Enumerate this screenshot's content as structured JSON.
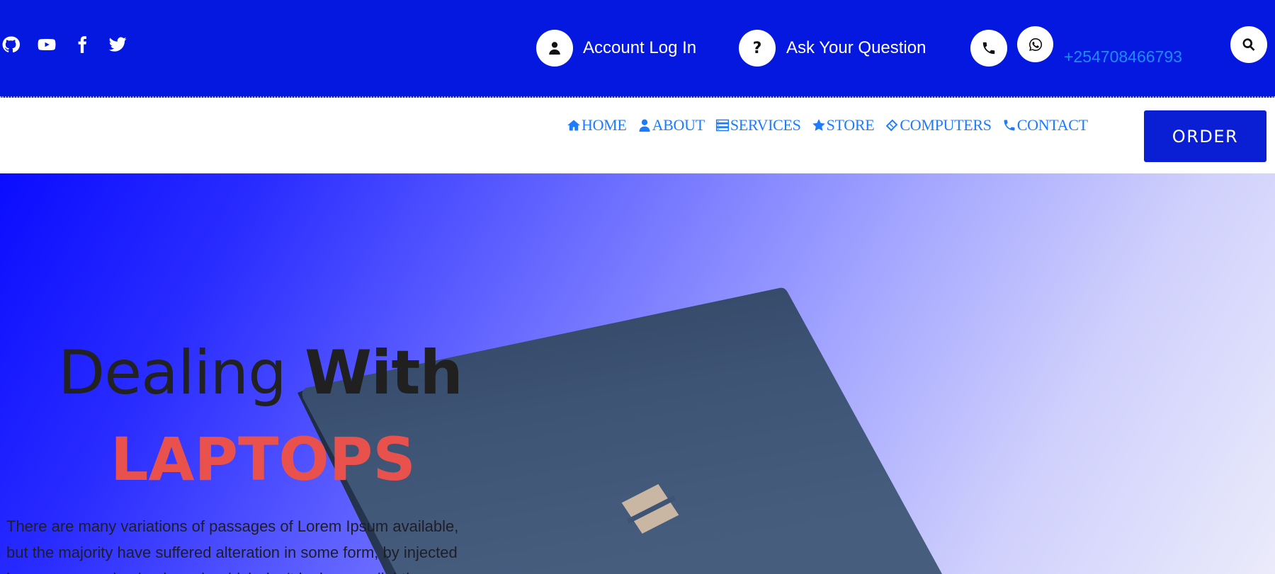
{
  "topbar": {
    "social_icons": [
      "github-icon",
      "youtube-icon",
      "facebook-icon",
      "twitter-icon"
    ],
    "account_label": "Account Log In",
    "question_label": "Ask Your Question",
    "phone_number": "+254708466793"
  },
  "nav": {
    "items": [
      {
        "icon": "home-icon",
        "label": "HOME"
      },
      {
        "icon": "user-icon",
        "label": "ABOUT"
      },
      {
        "icon": "server-icon",
        "label": "SERVICES"
      },
      {
        "icon": "star-icon",
        "label": "STORE"
      },
      {
        "icon": "ticket-icon",
        "label": "COMPUTERS"
      },
      {
        "icon": "phone-icon",
        "label": "CONTACT"
      }
    ],
    "order_label": "ORDER"
  },
  "hero": {
    "headline_light": "Dealing",
    "headline_bold": "With",
    "subheadline": "LAPTOPS",
    "body": "There are many variations of passages of Lorem Ipsum available, but the majority have suffered alteration in some form, by injected humour, or randomised words which don't look even slightly"
  },
  "colors": {
    "topbar_bg": "#0518e0",
    "nav_link": "#1d7bff",
    "order_bg": "#0a1fd4",
    "accent_red": "#e8514c",
    "phone_text": "#1d8cff"
  }
}
